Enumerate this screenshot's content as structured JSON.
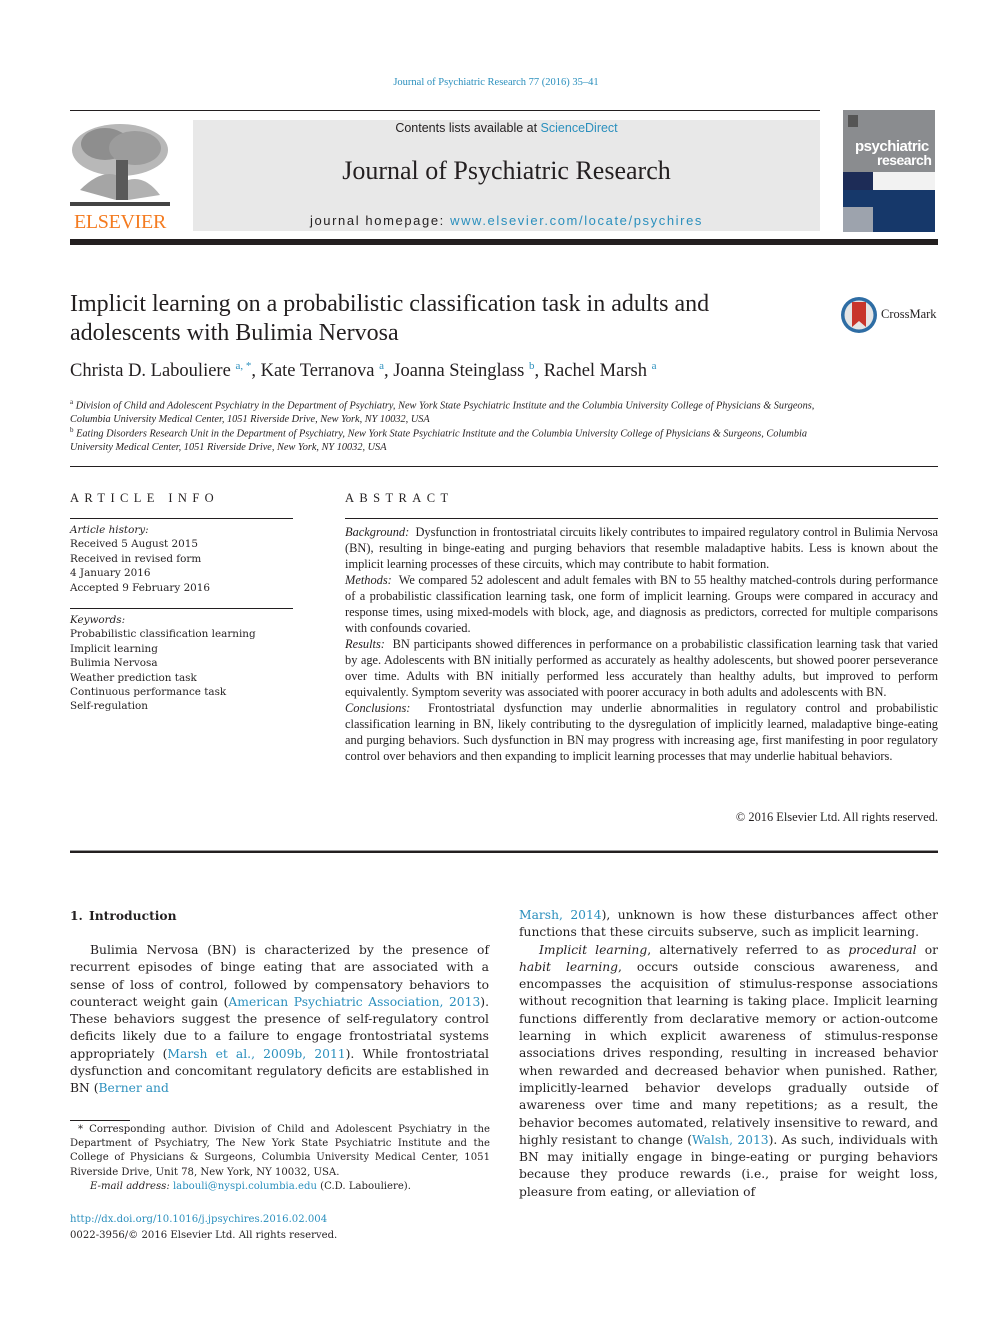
{
  "running_head": "Journal of Psychiatric Research 77 (2016) 35–41",
  "masthead": {
    "publisher_name": "ELSEVIER",
    "contents_prefix": "Contents lists available at ",
    "contents_link": "ScienceDirect",
    "journal_name": "Journal of Psychiatric Research",
    "homepage_prefix": "journal homepage: ",
    "homepage_link": "www.elsevier.com/locate/psychires",
    "cover_title_line1": "psychiatric",
    "cover_title_line2": "research"
  },
  "article": {
    "title": "Implicit learning on a probabilistic classification task in adults and adolescents with Bulimia Nervosa",
    "crossmark_label": "CrossMark",
    "authors": [
      {
        "name": "Christa D. Labouliere",
        "sup": "a, *",
        "sep": ", "
      },
      {
        "name": "Kate Terranova",
        "sup": "a",
        "sep": ", "
      },
      {
        "name": "Joanna Steinglass",
        "sup": "b",
        "sep": ", "
      },
      {
        "name": "Rachel Marsh",
        "sup": "a",
        "sep": ""
      }
    ],
    "affiliations": [
      {
        "label": "a",
        "text": "Division of Child and Adolescent Psychiatry in the Department of Psychiatry, New York State Psychiatric Institute and the Columbia University College of Physicians & Surgeons, Columbia University Medical Center, 1051 Riverside Drive, New York, NY 10032, USA"
      },
      {
        "label": "b",
        "text": "Eating Disorders Research Unit in the Department of Psychiatry, New York State Psychiatric Institute and the Columbia University College of Physicians & Surgeons, Columbia University Medical Center, 1051 Riverside Drive, New York, NY 10032, USA"
      }
    ]
  },
  "article_info": {
    "heading": "ARTICLE INFO",
    "history_label": "Article history:",
    "history": [
      "Received 5 August 2015",
      "Received in revised form",
      "4 January 2016",
      "Accepted 9 February 2016"
    ],
    "keywords_label": "Keywords:",
    "keywords": [
      "Probabilistic classification learning",
      "Implicit learning",
      "Bulimia Nervosa",
      "Weather prediction task",
      "Continuous performance task",
      "Self-regulation"
    ]
  },
  "abstract": {
    "heading": "ABSTRACT",
    "sections": [
      {
        "label": "Background:",
        "text": "Dysfunction in frontostriatal circuits likely contributes to impaired regulatory control in Bulimia Nervosa (BN), resulting in binge-eating and purging behaviors that resemble maladaptive habits. Less is known about the implicit learning processes of these circuits, which may contribute to habit formation."
      },
      {
        "label": "Methods:",
        "text": "We compared 52 adolescent and adult females with BN to 55 healthy matched-controls during performance of a probabilistic classification learning task, one form of implicit learning. Groups were compared in accuracy and response times, using mixed-models with block, age, and diagnosis as predictors, corrected for multiple comparisons with confounds covaried."
      },
      {
        "label": "Results:",
        "text": "BN participants showed differences in performance on a probabilistic classification learning task that varied by age. Adolescents with BN initially performed as accurately as healthy adolescents, but showed poorer perseverance over time. Adults with BN initially performed less accurately than healthy adults, but improved to perform equivalently. Symptom severity was associated with poorer accuracy in both adults and adolescents with BN."
      },
      {
        "label": "Conclusions:",
        "text": "Frontostriatal dysfunction may underlie abnormalities in regulatory control and probabilistic classification learning in BN, likely contributing to the dysregulation of implicitly learned, maladaptive binge-eating and purging behaviors. Such dysfunction in BN may progress with increasing age, first manifesting in poor regulatory control over behaviors and then expanding to implicit learning processes that may underlie habitual behaviors."
      }
    ],
    "copyright": "© 2016 Elsevier Ltd. All rights reserved."
  },
  "body": {
    "intro_heading": "1. Introduction",
    "left_p1": [
      {
        "t": "Bulimia Nervosa (BN) is characterized by the presence of recurrent episodes of binge eating that are associated with a sense of loss of control, followed by compensatory behaviors to counteract weight gain ("
      },
      {
        "link": "American Psychiatric Association, 2013"
      },
      {
        "t": "). These behaviors suggest the presence of self-regulatory control deficits likely due to a failure to engage frontostriatal systems appropriately ("
      },
      {
        "link": "Marsh et al., 2009b, 2011"
      },
      {
        "t": "). While frontostriatal dysfunction and concomitant regulatory deficits are established in BN ("
      },
      {
        "link": "Berner and"
      }
    ],
    "right_p1": [
      {
        "link": "Marsh, 2014"
      },
      {
        "t": "), unknown is how these disturbances affect other functions that these circuits subserve, such as implicit learning."
      }
    ],
    "right_p2": [
      {
        "it": "Implicit learning"
      },
      {
        "t": ", alternatively referred to as "
      },
      {
        "it": "procedural"
      },
      {
        "t": " or "
      },
      {
        "it": "habit learning"
      },
      {
        "t": ", occurs outside conscious awareness, and encompasses the acquisition of stimulus-response associations without recognition that learning is taking place. Implicit learning functions differently from declarative memory or action-outcome learning in which explicit awareness of stimulus-response associations drives responding, resulting in increased behavior when rewarded and decreased behavior when punished. Rather, implicitly-learned behavior develops gradually outside of awareness over time and many repetitions; as a result, the behavior becomes automated, relatively insensitive to reward, and highly resistant to change ("
      },
      {
        "link": "Walsh, 2013"
      },
      {
        "t": "). As such, individuals with BN may initially engage in binge-eating or purging behaviors because they produce rewards (i.e., praise for weight loss, pleasure from eating, or alleviation of"
      }
    ]
  },
  "footnote": {
    "corresponding": "* Corresponding author. Division of Child and Adolescent Psychiatry in the Department of Psychiatry, The New York State Psychiatric Institute and the College of Physicians & Surgeons, Columbia University Medical Center, 1051 Riverside Drive, Unit 78, New York, NY 10032, USA.",
    "email_label": "E-mail address:",
    "email": "labouli@nyspi.columbia.edu",
    "email_suffix": " (C.D. Labouliere).",
    "doi": "http://dx.doi.org/10.1016/j.jpsychires.2016.02.004",
    "issn": "0022-3956/© 2016 Elsevier Ltd. All rights reserved."
  },
  "colors": {
    "link": "#2a8fbd",
    "elsevier_orange": "#f47b20",
    "masthead_bg": "#e8e8e8",
    "text": "#231f20"
  }
}
